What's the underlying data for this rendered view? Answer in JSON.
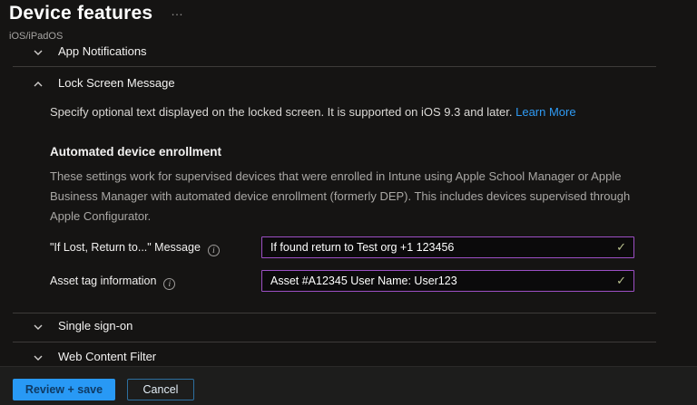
{
  "header": {
    "title": "Device features",
    "subtitle": "iOS/iPadOS"
  },
  "icons": {
    "more": "…",
    "info": "i",
    "check": "✓"
  },
  "sections": [
    {
      "label": "App Notifications",
      "state": "collapsed"
    },
    {
      "label": "Lock Screen Message",
      "state": "expanded"
    },
    {
      "label": "Single sign-on",
      "state": "collapsed"
    },
    {
      "label": "Web Content Filter",
      "state": "collapsed"
    }
  ],
  "lock_screen": {
    "description": "Specify optional text displayed on the locked screen. It is supported on iOS 9.3 and later.",
    "learn_more_label": "Learn More",
    "subheading": "Automated device enrollment",
    "paragraph": "These settings work for supervised devices that were enrolled in Intune using Apple School Manager or Apple Business Manager with automated device enrollment (formerly DEP). This includes devices supervised through Apple Configurator.",
    "fields": [
      {
        "label": "\"If Lost, Return to...\" Message",
        "value": "If found return to Test org +1 123456",
        "valid": true
      },
      {
        "label": "Asset tag information",
        "value": "Asset #A12345 User Name: User123",
        "valid": true
      }
    ]
  },
  "footer": {
    "primary_label": "Review + save",
    "secondary_label": "Cancel"
  },
  "colors": {
    "accent_blue": "#2899f5",
    "link_blue": "#2f9bf4",
    "input_border_purple": "#9c4fc4",
    "valid_check_green": "#b9c18e",
    "background": "#151413"
  }
}
